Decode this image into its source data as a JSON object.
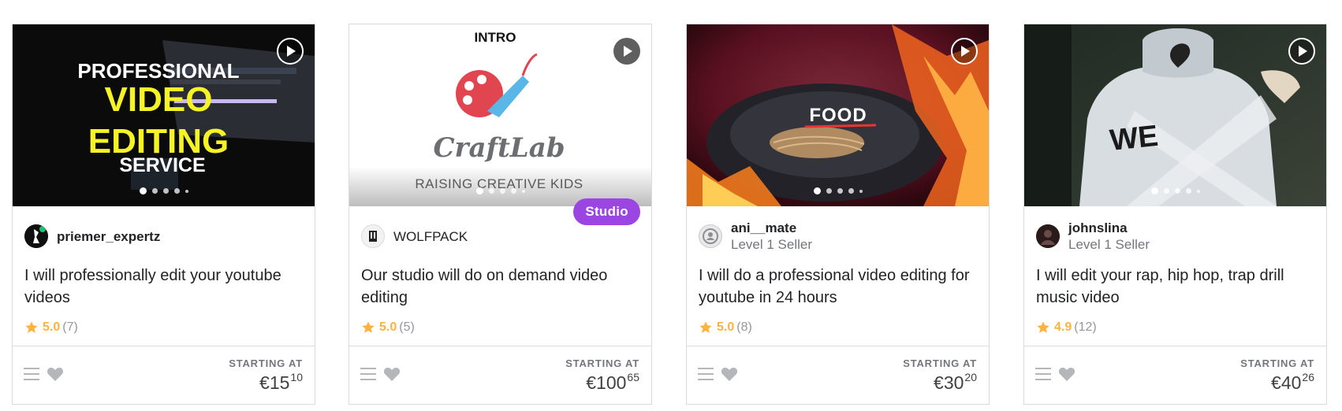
{
  "cards": [
    {
      "thumbnail": {
        "lines": [
          "PROFESSIONAL",
          "VIDEO",
          "EDITING",
          "SERVICE"
        ],
        "colors": {
          "white": "#ffffff",
          "yellow": "#f5f225"
        }
      },
      "seller": {
        "name": "priemer_expertz",
        "level": ""
      },
      "title": "I will professionally edit your youtube videos",
      "rating": {
        "score": "5.0",
        "count": "(7)"
      },
      "price": {
        "label": "STARTING AT",
        "main": "€15",
        "cents": "10"
      }
    },
    {
      "thumbnail": {
        "top_text": "INTRO",
        "logo_text": "CraftLab",
        "bottom_text": "RAISING CREATIVE KIDS"
      },
      "badge": "Studio",
      "seller": {
        "name": "WOLFPACK",
        "level": ""
      },
      "title": "Our studio will do on demand video editing",
      "rating": {
        "score": "5.0",
        "count": "(5)"
      },
      "price": {
        "label": "STARTING AT",
        "main": "€100",
        "cents": "65"
      }
    },
    {
      "thumbnail": {
        "text": "FOOD"
      },
      "seller": {
        "name": "ani__mate",
        "level": "Level 1 Seller"
      },
      "title": "I will do a professional video editing for youtube in 24 hours",
      "rating": {
        "score": "5.0",
        "count": "(8)"
      },
      "price": {
        "label": "STARTING AT",
        "main": "€30",
        "cents": "20"
      }
    },
    {
      "thumbnail": {
        "text": "WE"
      },
      "seller": {
        "name": "johnslina",
        "level": "Level 1 Seller"
      },
      "title": "I will edit your rap, hip hop, trap drill music video",
      "rating": {
        "score": "4.9",
        "count": "(12)"
      },
      "price": {
        "label": "STARTING AT",
        "main": "€40",
        "cents": "26"
      }
    }
  ],
  "colors": {
    "star": "#ffb33e",
    "studio_badge": "#9b46e3",
    "border": "#dadbdd",
    "muted_text": "#74767e"
  },
  "icons": [
    "play-icon",
    "menu-icon",
    "heart-icon",
    "star-icon"
  ]
}
